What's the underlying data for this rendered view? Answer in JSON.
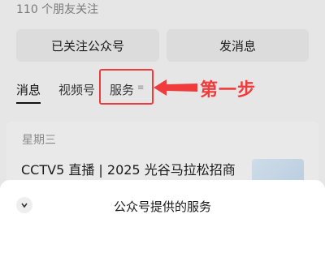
{
  "header": {
    "followers_text": "110 个朋友关注"
  },
  "actions": {
    "follow_label": "已关注公众号",
    "message_label": "发消息"
  },
  "tabs": [
    {
      "label": "消息",
      "active": true
    },
    {
      "label": "视频号",
      "active": false
    },
    {
      "label": "服务",
      "active": false
    }
  ],
  "annotation": {
    "text": "第一步",
    "color": "#ef3b3b"
  },
  "feed": {
    "date_label": "星期三",
    "article_title": "CCTV5 直播 | 2025 光谷马拉松招商"
  },
  "sheet": {
    "title": "公众号提供的服务"
  },
  "icons": {
    "services_menu": "menu-lines-icon",
    "sheet_collapse": "chevron-down-icon",
    "annotation_arrow": "arrow-left-icon"
  }
}
